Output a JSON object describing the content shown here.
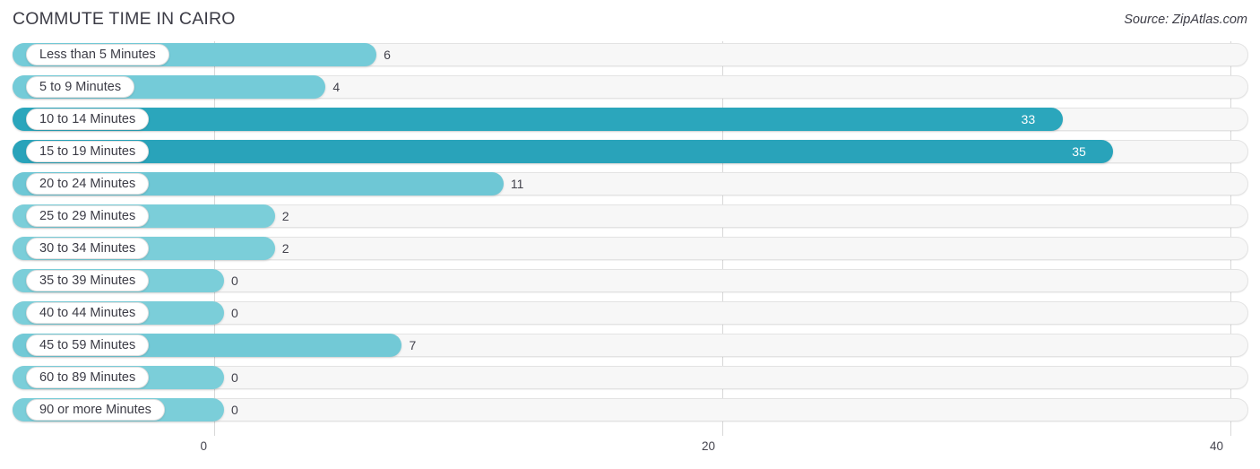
{
  "header": {
    "title": "COMMUTE TIME IN CAIRO",
    "source": "Source: ZipAtlas.com"
  },
  "colors": {
    "bar_light": "#74cbd8",
    "bar_dark": "#2ba6bc",
    "track": "#f7f7f7",
    "track_border": "#e3e3e3",
    "gridline": "#d8d8d8",
    "text": "#3c3c46",
    "value_in_text": "#ffffff"
  },
  "chart_data": {
    "type": "bar",
    "orientation": "horizontal",
    "title": "COMMUTE TIME IN CAIRO",
    "xlabel": "",
    "ylabel": "",
    "xlim": [
      0,
      40
    ],
    "ticks": [
      "0",
      "20",
      "40"
    ],
    "tick_values": [
      0,
      20,
      40
    ],
    "grid": true,
    "legend": false,
    "categories": [
      "Less than 5 Minutes",
      "5 to 9 Minutes",
      "10 to 14 Minutes",
      "15 to 19 Minutes",
      "20 to 24 Minutes",
      "25 to 29 Minutes",
      "30 to 34 Minutes",
      "35 to 39 Minutes",
      "40 to 44 Minutes",
      "45 to 59 Minutes",
      "60 to 89 Minutes",
      "90 or more Minutes"
    ],
    "values": [
      6,
      4,
      33,
      35,
      11,
      2,
      2,
      0,
      0,
      7,
      0,
      0
    ],
    "value_labels": [
      "6",
      "4",
      "33",
      "35",
      "11",
      "2",
      "2",
      "0",
      "0",
      "7",
      "0",
      "0"
    ]
  },
  "rows": [
    {
      "label": "Less than 5 Minutes",
      "value": 6,
      "value_label": "6",
      "color": "#74cbd8",
      "label_inside": false
    },
    {
      "label": "5 to 9 Minutes",
      "value": 4,
      "value_label": "4",
      "color": "#74cbd8",
      "label_inside": false
    },
    {
      "label": "10 to 14 Minutes",
      "value": 33,
      "value_label": "33",
      "color": "#2ba6bc",
      "label_inside": true
    },
    {
      "label": "15 to 19 Minutes",
      "value": 35,
      "value_label": "35",
      "color": "#29a3ba",
      "label_inside": true
    },
    {
      "label": "20 to 24 Minutes",
      "value": 11,
      "value_label": "11",
      "color": "#6ec7d5",
      "label_inside": false
    },
    {
      "label": "25 to 29 Minutes",
      "value": 2,
      "value_label": "2",
      "color": "#7bced9",
      "label_inside": false
    },
    {
      "label": "30 to 34 Minutes",
      "value": 2,
      "value_label": "2",
      "color": "#7bced9",
      "label_inside": false
    },
    {
      "label": "35 to 39 Minutes",
      "value": 0,
      "value_label": "0",
      "color": "#7bced9",
      "label_inside": false
    },
    {
      "label": "40 to 44 Minutes",
      "value": 0,
      "value_label": "0",
      "color": "#7bced9",
      "label_inside": false
    },
    {
      "label": "45 to 59 Minutes",
      "value": 7,
      "value_label": "7",
      "color": "#72c9d6",
      "label_inside": false
    },
    {
      "label": "60 to 89 Minutes",
      "value": 0,
      "value_label": "0",
      "color": "#7bced9",
      "label_inside": false
    },
    {
      "label": "90 or more Minutes",
      "value": 0,
      "value_label": "0",
      "color": "#7bced9",
      "label_inside": false
    }
  ],
  "axis": {
    "ticks": [
      {
        "label": "0",
        "value": 0
      },
      {
        "label": "20",
        "value": 20
      },
      {
        "label": "40",
        "value": 40
      }
    ]
  }
}
